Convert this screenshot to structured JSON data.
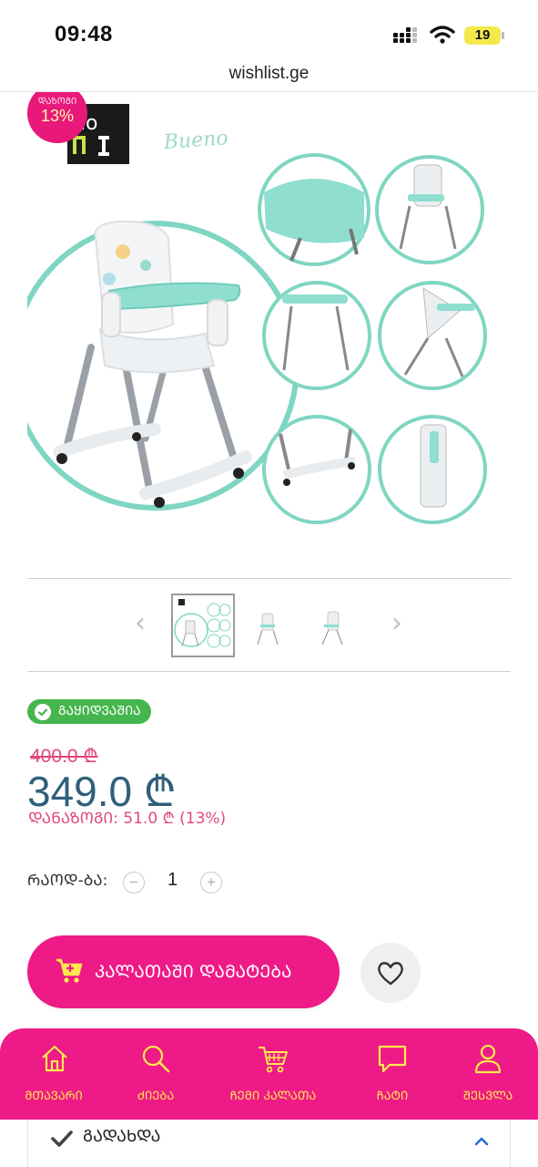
{
  "status_bar": {
    "time": "09:48",
    "battery": "19"
  },
  "browser": {
    "url": "wishlist.ge"
  },
  "product": {
    "discount_badge": {
      "label": "ᲓᲐᲖᲝᲒᲘ",
      "value": "13%"
    },
    "image_alt": "high chair product image"
  },
  "thumbnails": [
    {
      "name": "thumb-collage",
      "active": true
    },
    {
      "name": "thumb-chair-front",
      "active": false
    },
    {
      "name": "thumb-chair-side",
      "active": false
    }
  ],
  "stock": {
    "label": "ᲒᲐᲧᲘᲓᲕᲐᲨᲘᲐ"
  },
  "price": {
    "old": "400.0 ₾",
    "new": "349.0 ₾",
    "saving": "ᲓᲐᲜᲐᲖᲝᲒᲘ: 51.0 ₾ (13%)"
  },
  "quantity": {
    "label": "ᲠᲐᲝᲓ-ᲑᲐ:",
    "minus": "−",
    "value": "1",
    "plus": "+"
  },
  "cart": {
    "add_label": "ᲙᲐᲚᲐᲗᲐᲨᲘ ᲓᲐᲛᲐᲢᲔᲑᲐ"
  },
  "nav": {
    "items": [
      {
        "label": "ᲛᲗᲐᲕᲐᲠᲘ",
        "icon": "home-icon"
      },
      {
        "label": "ᲫᲘᲔᲑᲐ",
        "icon": "search-icon"
      },
      {
        "label": "ᲩᲔᲛᲘ ᲙᲐᲚᲐᲗᲐ",
        "icon": "cart-icon"
      },
      {
        "label": "ᲩᲐᲢᲘ",
        "icon": "chat-icon"
      },
      {
        "label": "ᲨᲔᲡᲕᲚᲐ",
        "icon": "user-icon"
      }
    ]
  },
  "delivery": {
    "label": "ᲒᲐᲓᲐᲮᲓᲐ"
  },
  "colors": {
    "accent": "#ee1a87",
    "price": "#2f5f7a",
    "stock": "#45b64d",
    "nav_text": "#ffe94d",
    "mint": "#7fd6c2"
  }
}
